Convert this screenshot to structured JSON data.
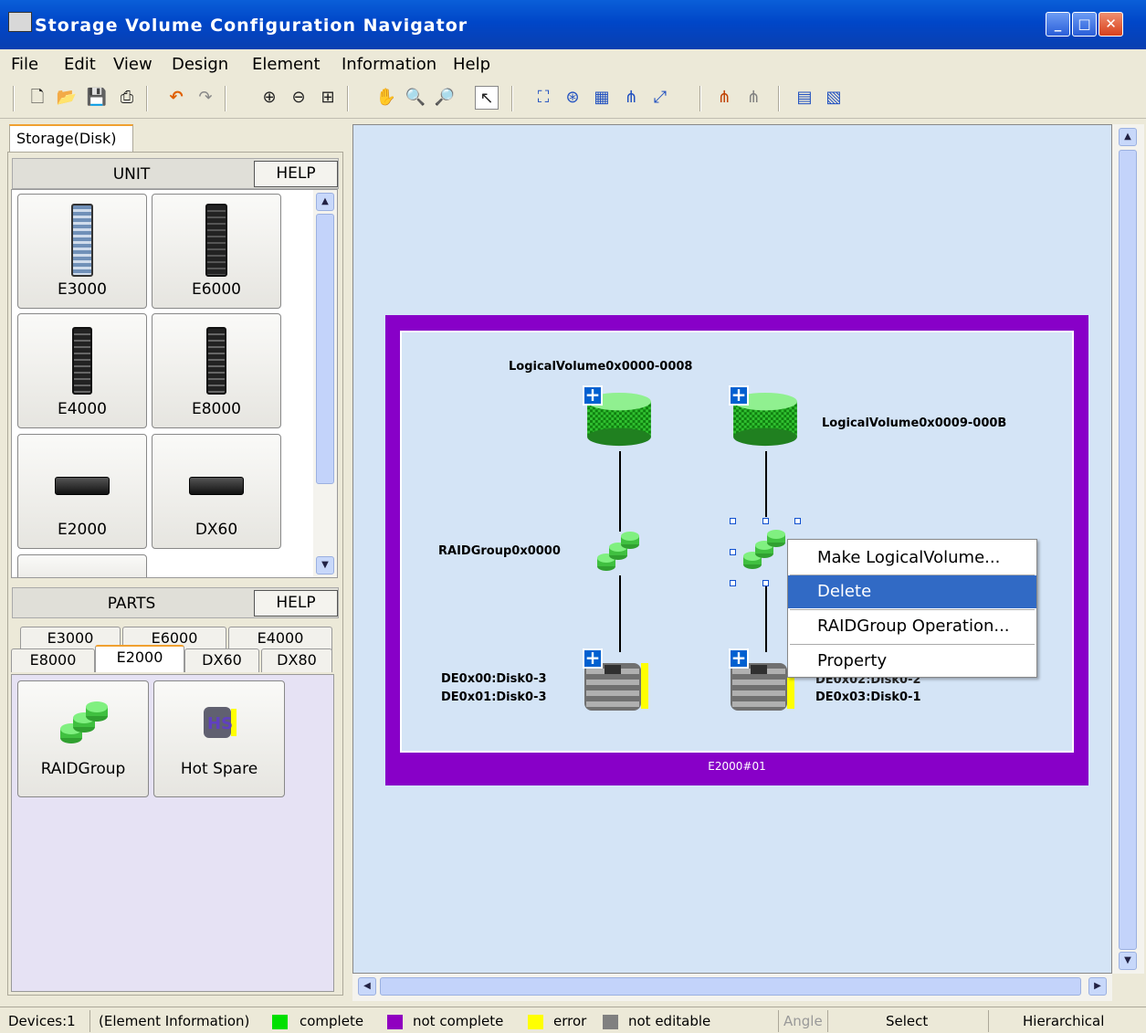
{
  "window": {
    "title": "Storage Volume Configuration Navigator"
  },
  "menu": [
    "File",
    "Edit",
    "View",
    "Design",
    "Element",
    "Information",
    "Help"
  ],
  "left_panel": {
    "tab": "Storage(Disk)",
    "unit": {
      "header": "UNIT",
      "help": "HELP",
      "items": [
        "E3000",
        "E6000",
        "E4000",
        "E8000",
        "E2000",
        "DX60"
      ]
    },
    "parts": {
      "header": "PARTS",
      "help": "HELP",
      "tabs_row1": [
        "E3000",
        "E6000",
        "E4000"
      ],
      "tabs_row2": [
        "E8000",
        "E2000",
        "DX60",
        "DX80"
      ],
      "selected_tab": "E2000",
      "items": [
        "RAIDGroup",
        "Hot Spare"
      ]
    }
  },
  "diagram": {
    "frame_label": "E2000#01",
    "lv1": "LogicalVolume0x0000-0008",
    "lv2": "LogicalVolume0x0009-000B",
    "rg1": "RAIDGroup0x0000",
    "disk1_line1": "DE0x00:Disk0-3",
    "disk1_line2": "DE0x01:Disk0-3",
    "disk2_line1": "DE0x02:Disk0-2",
    "disk2_line2": "DE0x03:Disk0-1"
  },
  "context_menu": {
    "items": [
      "Make LogicalVolume...",
      "Delete",
      "RAIDGroup Operation...",
      "Property"
    ],
    "highlighted": "Delete"
  },
  "status": {
    "devices": "Devices:1",
    "info": "(Element Information)",
    "legend": [
      {
        "label": "complete",
        "color": "#00e000"
      },
      {
        "label": "not complete",
        "color": "#9000c0"
      },
      {
        "label": "error",
        "color": "#ffff00"
      },
      {
        "label": "not editable",
        "color": "#808080"
      }
    ],
    "angle": "Angle",
    "mode": "Select",
    "layout": "Hierarchical"
  }
}
